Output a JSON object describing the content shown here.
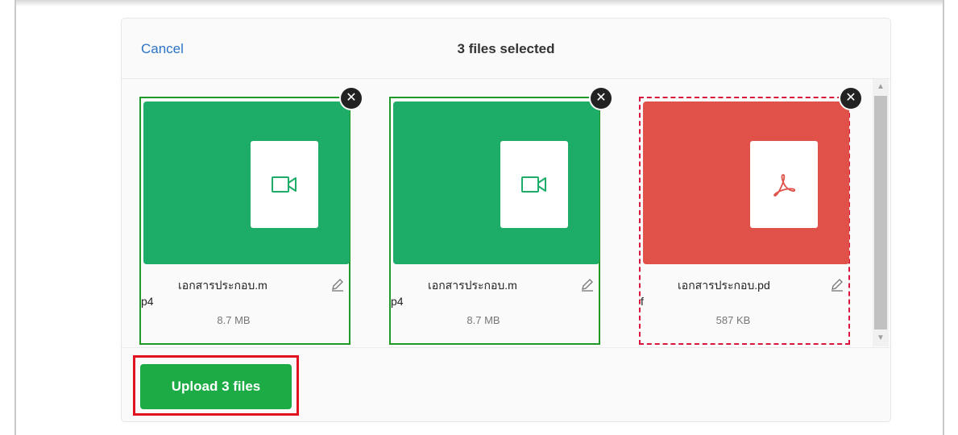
{
  "dialog": {
    "cancel_label": "Cancel",
    "title": "3 files selected"
  },
  "files": [
    {
      "name_line1": "เอกสารประกอบ.m",
      "name_line2": "p4",
      "size": "8.7 MB",
      "type_icon": "video-camera-icon",
      "thumb_color": "#1dad68",
      "status": "ok"
    },
    {
      "name_line1": "เอกสารประกอบ.m",
      "name_line2": "p4",
      "size": "8.7 MB",
      "type_icon": "video-camera-icon",
      "thumb_color": "#1dad68",
      "status": "ok"
    },
    {
      "name_line1": "เอกสารประกอบ.pd",
      "name_line2": "f",
      "size": "587 KB",
      "type_icon": "pdf-icon",
      "thumb_color": "#e0514a",
      "status": "error"
    }
  ],
  "footer": {
    "upload_label": "Upload 3 files"
  },
  "colors": {
    "accent_green": "#1dab45",
    "error_red": "#d9173c",
    "link_blue": "#2a74c8"
  }
}
